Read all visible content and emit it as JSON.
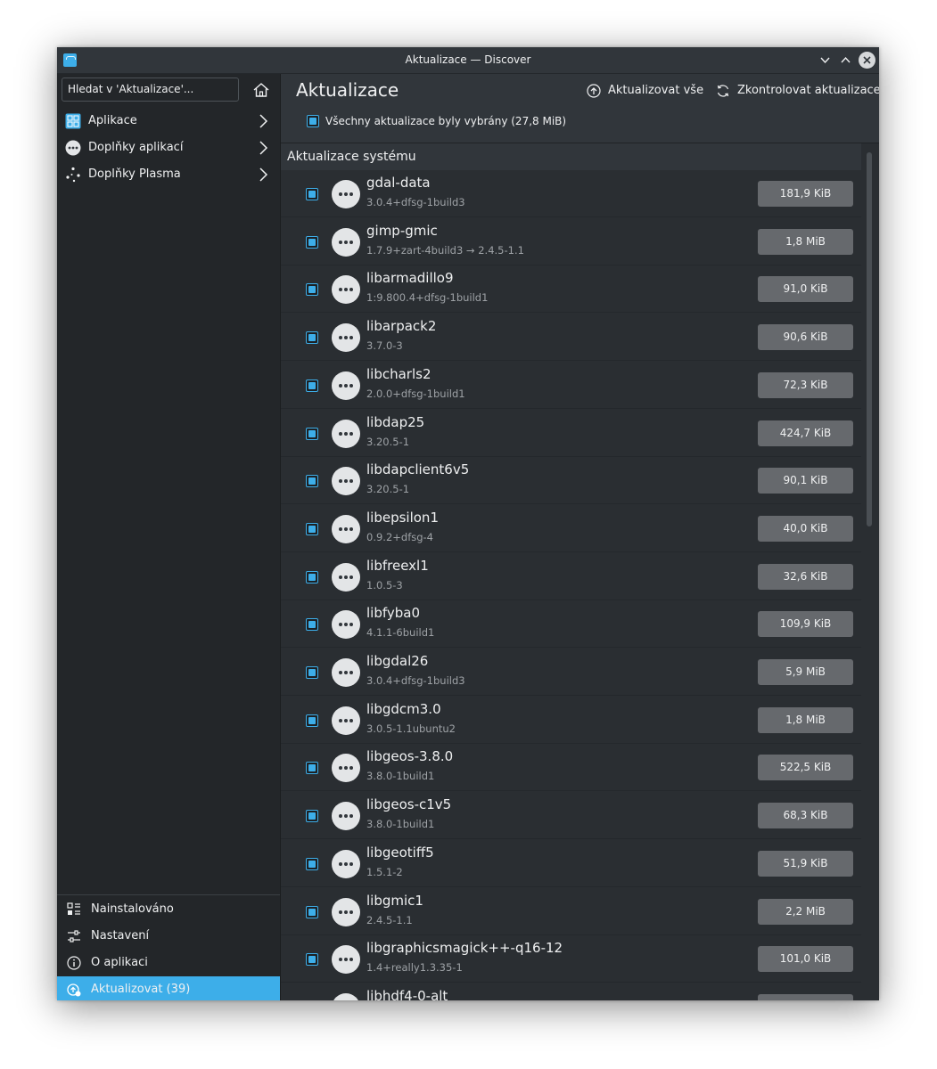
{
  "window": {
    "title": "Aktualizace — Discover",
    "minimize_glyph": "⌄",
    "maximize_glyph": "⌃",
    "close_glyph": "✕"
  },
  "sidebar": {
    "search_placeholder": "Hledat v 'Aktualizace'...",
    "categories": [
      {
        "label": "Aplikace",
        "icon": "applications-grid-icon"
      },
      {
        "label": "Doplňky aplikací",
        "icon": "more-circle-icon"
      },
      {
        "label": "Doplňky Plasma",
        "icon": "plasma-icon"
      }
    ],
    "bottom_nav": [
      {
        "label": "Nainstalováno",
        "icon": "installed-list-icon",
        "active": false
      },
      {
        "label": "Nastavení",
        "icon": "settings-sliders-icon",
        "active": false
      },
      {
        "label": "O aplikaci",
        "icon": "info-icon",
        "active": false
      },
      {
        "label": "Aktualizovat (39)",
        "icon": "update-icon",
        "active": true
      }
    ]
  },
  "header": {
    "title": "Aktualizace",
    "update_all_label": "Aktualizovat vše",
    "check_updates_label": "Zkontrolovat aktualizace",
    "selection_summary": "Všechny aktualizace byly vybrány (27,8 MiB)"
  },
  "section": {
    "title": "Aktualizace systému"
  },
  "packages": [
    {
      "name": "gdal-data",
      "version": "3.0.4+dfsg-1build3",
      "size": "181,9 KiB",
      "checked": true
    },
    {
      "name": "gimp-gmic",
      "version": "1.7.9+zart-4build3 → 2.4.5-1.1",
      "size": "1,8 MiB",
      "checked": true
    },
    {
      "name": "libarmadillo9",
      "version": "1:9.800.4+dfsg-1build1",
      "size": "91,0 KiB",
      "checked": true
    },
    {
      "name": "libarpack2",
      "version": "3.7.0-3",
      "size": "90,6 KiB",
      "checked": true
    },
    {
      "name": "libcharls2",
      "version": "2.0.0+dfsg-1build1",
      "size": "72,3 KiB",
      "checked": true
    },
    {
      "name": "libdap25",
      "version": "3.20.5-1",
      "size": "424,7 KiB",
      "checked": true
    },
    {
      "name": "libdapclient6v5",
      "version": "3.20.5-1",
      "size": "90,1 KiB",
      "checked": true
    },
    {
      "name": "libepsilon1",
      "version": "0.9.2+dfsg-4",
      "size": "40,0 KiB",
      "checked": true
    },
    {
      "name": "libfreexl1",
      "version": "1.0.5-3",
      "size": "32,6 KiB",
      "checked": true
    },
    {
      "name": "libfyba0",
      "version": "4.1.1-6build1",
      "size": "109,9 KiB",
      "checked": true
    },
    {
      "name": "libgdal26",
      "version": "3.0.4+dfsg-1build3",
      "size": "5,9 MiB",
      "checked": true
    },
    {
      "name": "libgdcm3.0",
      "version": "3.0.5-1.1ubuntu2",
      "size": "1,8 MiB",
      "checked": true
    },
    {
      "name": "libgeos-3.8.0",
      "version": "3.8.0-1build1",
      "size": "522,5 KiB",
      "checked": true
    },
    {
      "name": "libgeos-c1v5",
      "version": "3.8.0-1build1",
      "size": "68,3 KiB",
      "checked": true
    },
    {
      "name": "libgeotiff5",
      "version": "1.5.1-2",
      "size": "51,9 KiB",
      "checked": true
    },
    {
      "name": "libgmic1",
      "version": "2.4.5-1.1",
      "size": "2,2 MiB",
      "checked": true
    },
    {
      "name": "libgraphicsmagick++-q16-12",
      "version": "1.4+really1.3.35-1",
      "size": "101,0 KiB",
      "checked": true
    },
    {
      "name": "libhdf4-0-alt",
      "version": "",
      "size": "",
      "checked": true
    }
  ],
  "colors": {
    "accent": "#3daee9",
    "window_bg": "#2a2e32",
    "sidebar_bg": "#232629",
    "size_badge": "#66696d"
  }
}
